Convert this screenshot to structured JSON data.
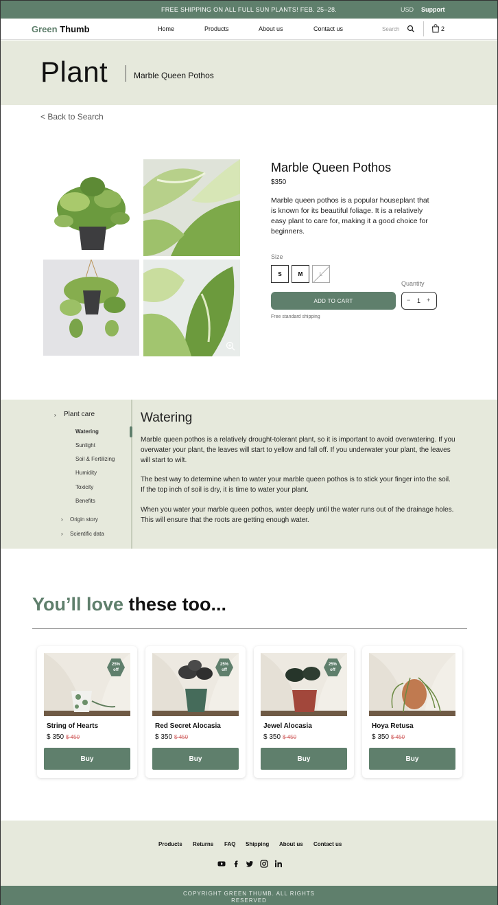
{
  "topbar": {
    "promo": "FREE SHIPPING ON ALL FULL SUN PLANTS! FEB. 25–28.",
    "currency": "USD",
    "support": "Support"
  },
  "nav": {
    "logo_a": "Green",
    "logo_b": " Thumb",
    "links": [
      "Home",
      "Products",
      "About us",
      "Contact us"
    ],
    "search_placeholder": "Search",
    "cart_count": "2"
  },
  "hero": {
    "title": "Plant",
    "subtitle": "Marble Queen Pothos"
  },
  "back_link": "< Back to Search",
  "product": {
    "name": "Marble Queen Pothos",
    "price": "$350",
    "description": "Marble queen pothos is a popular houseplant that is known for its beautiful foliage. It is a relatively easy plant to care for, making it a good choice for beginners.",
    "size_label": "Size",
    "sizes": [
      "S",
      "M",
      "L"
    ],
    "quantity_label": "Quantity",
    "quantity": "1",
    "add_to_cart": "ADD TO CART",
    "shipping_note": "Free standard shipping"
  },
  "care": {
    "section": "Plant care",
    "items": [
      "Watering",
      "Sunlight",
      "Soil & Fertilizing",
      "Humidity",
      "Toxicity",
      "Benefits"
    ],
    "other_sections": [
      "Origin story",
      "Scientific data"
    ],
    "heading": "Watering",
    "paragraphs": [
      "Marble queen pothos is a relatively drought-tolerant plant, so it is important to avoid overwatering. If you overwater your plant, the leaves will start to yellow and fall off. If you underwater your plant, the leaves will start to wilt.",
      "The best way to determine when to water your marble queen pothos is to stick your finger into the soil. If the top inch of soil is dry, it is time to water your plant.",
      "When you water your marble queen pothos, water deeply until the water runs out of the drainage holes. This will ensure that the roots are getting enough water."
    ]
  },
  "recommend": {
    "title_a": "You’ll love",
    "title_b": " these too...",
    "cards": [
      {
        "name": "String of Hearts",
        "price": "$ 350",
        "old": "$ 450",
        "badge": "25%\noff",
        "buy": "Buy"
      },
      {
        "name": "Red Secret Alocasia",
        "price": "$ 350",
        "old": "$ 450",
        "badge": "25%\noff",
        "buy": "Buy"
      },
      {
        "name": "Jewel Alocasia",
        "price": "$ 350",
        "old": "$ 450",
        "badge": "25%\noff",
        "buy": "Buy"
      },
      {
        "name": "Hoya Retusa",
        "price": "$ 350",
        "old": "$ 450",
        "buy": "Buy"
      }
    ]
  },
  "footer": {
    "links": [
      "Products",
      "Returns",
      "FAQ",
      "Shipping",
      "About us",
      "Contact us"
    ],
    "social_icons": [
      "youtube-icon",
      "facebook-icon",
      "twitter-icon",
      "instagram-icon",
      "linkedin-icon"
    ],
    "copyright": "COPYRIGHT GREEN THUMB. ALL RIGHTS RESERVED"
  },
  "colors": {
    "accent": "#5f7f6c",
    "panel": "#e6e9dc",
    "sale": "#d46a6a"
  }
}
